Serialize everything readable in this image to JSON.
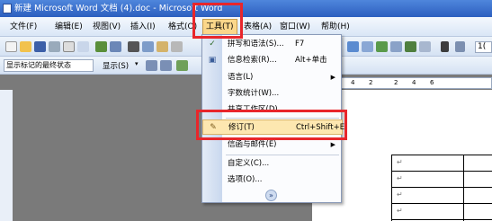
{
  "window": {
    "title": "新建 Microsoft Word 文档 (4).doc - Microsoft Word"
  },
  "menubar": {
    "items": [
      {
        "label": "文件(F)"
      },
      {
        "label": "编辑(E)"
      },
      {
        "label": "视图(V)"
      },
      {
        "label": "插入(I)"
      },
      {
        "label": "格式(O)"
      },
      {
        "label": "工具(T)"
      },
      {
        "label": "表格(A)"
      },
      {
        "label": "窗口(W)"
      },
      {
        "label": "帮助(H)"
      }
    ],
    "active": "工具(T)"
  },
  "toolbar2": {
    "markup_mode": "显示标记的最终状态",
    "show_label": "显示(S)"
  },
  "ruler": {
    "labels": [
      "4",
      "2",
      "2",
      "4",
      "6"
    ]
  },
  "zoom_fragment": "1(",
  "tools_menu": {
    "items": [
      {
        "label": "拼写和语法(S)...",
        "shortcut": "F7",
        "icon": "spelling-icon"
      },
      {
        "label": "信息检索(R)...",
        "shortcut": "Alt+单击",
        "icon": "research-icon"
      },
      {
        "label": "语言(L)",
        "submenu": true
      },
      {
        "label": "字数统计(W)..."
      },
      {
        "label": "共享工作区(D)..."
      },
      {
        "label": "修订(T)",
        "shortcut": "Ctrl+Shift+E",
        "icon": "track-changes-icon",
        "highlighted": true
      },
      {
        "label": "信函与邮件(E)",
        "submenu": true
      },
      {
        "label": "自定义(C)..."
      },
      {
        "label": "选项(O)..."
      }
    ],
    "expand_glyph": "»"
  },
  "document": {
    "return_mark": "↵"
  },
  "colors": {
    "highlight_red": "#e8262b",
    "menu_hover": "#fde7b0"
  }
}
